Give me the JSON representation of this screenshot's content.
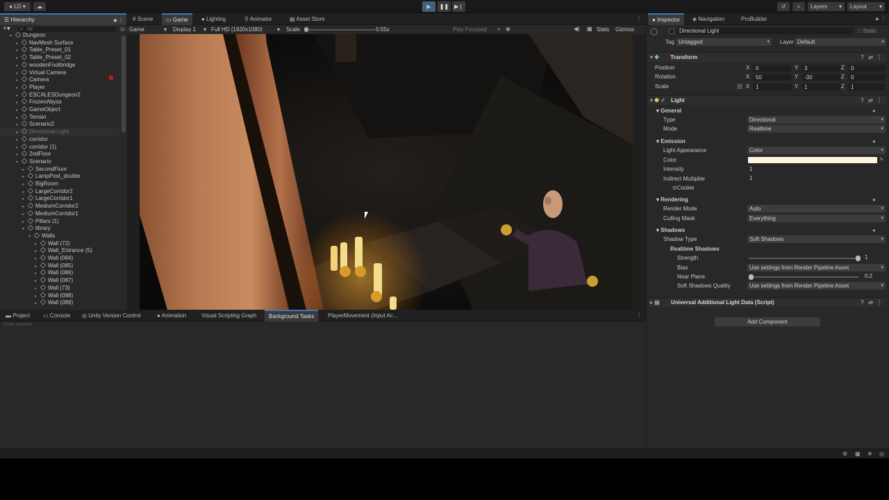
{
  "toolbar": {
    "account": "LD",
    "layers": "Layers",
    "layout": "Layout"
  },
  "hierarchy": {
    "tab": "Hierarchy",
    "search_placeholder": "All",
    "items": [
      {
        "label": "Dungeon",
        "indent": 0,
        "expanded": true
      },
      {
        "label": "NavMesh Surface",
        "indent": 1
      },
      {
        "label": "Table_Preset_01",
        "indent": 1
      },
      {
        "label": "Table_Preset_02",
        "indent": 1
      },
      {
        "label": "woodenFootbridge",
        "indent": 1
      },
      {
        "label": "Virtual Camera",
        "indent": 1
      },
      {
        "label": "Camera",
        "indent": 1
      },
      {
        "label": "Player",
        "indent": 1
      },
      {
        "label": "ESCALESDungeon2",
        "indent": 1
      },
      {
        "label": "FrozenAbyss",
        "indent": 1
      },
      {
        "label": "GameObject",
        "indent": 1
      },
      {
        "label": "Terrain",
        "indent": 1
      },
      {
        "label": "Scenario2",
        "indent": 1
      },
      {
        "label": "Directional Light",
        "indent": 1,
        "disabled": true
      },
      {
        "label": "corridor",
        "indent": 1
      },
      {
        "label": "corridor (1)",
        "indent": 1
      },
      {
        "label": "2ndFloor",
        "indent": 1
      },
      {
        "label": "Scenario",
        "indent": 1,
        "expanded": true
      },
      {
        "label": "SecondFloor",
        "indent": 2
      },
      {
        "label": "LampPost_double",
        "indent": 2
      },
      {
        "label": "BigRoom",
        "indent": 2
      },
      {
        "label": "LargeCorridor2",
        "indent": 2
      },
      {
        "label": "LargeCorridor1",
        "indent": 2
      },
      {
        "label": "MediumCorridor2",
        "indent": 2
      },
      {
        "label": "MediumCorridor1",
        "indent": 2
      },
      {
        "label": "Pillars (1)",
        "indent": 2
      },
      {
        "label": "library",
        "indent": 2,
        "expanded": true
      },
      {
        "label": "Walls",
        "indent": 3,
        "expanded": true
      },
      {
        "label": "Wall (72)",
        "indent": 4
      },
      {
        "label": "Wall_Entrance (5)",
        "indent": 4
      },
      {
        "label": "Wall (084)",
        "indent": 4
      },
      {
        "label": "Wall (085)",
        "indent": 4
      },
      {
        "label": "Wall (086)",
        "indent": 4
      },
      {
        "label": "Wall (087)",
        "indent": 4
      },
      {
        "label": "Wall (73)",
        "indent": 4
      },
      {
        "label": "Wall (088)",
        "indent": 4
      },
      {
        "label": "Wall (089)",
        "indent": 4
      }
    ]
  },
  "center_tabs": [
    "Scene",
    "Game",
    "Lighting",
    "Animator",
    "Asset Store"
  ],
  "game_bar": {
    "mode": "Game",
    "display": "Display 1",
    "resolution": "Full HD (1920x1080)",
    "scale_label": "Scale",
    "scale_value": "0.55x",
    "play_focused": "Play Focused",
    "stats": "Stats",
    "gizmos": "Gizmos"
  },
  "bottom_tabs": [
    "Project",
    "Console",
    "Unity Version Control",
    "Animation",
    "Visual Scripting Graph",
    "Background Tasks",
    "PlayerMovement (Input Ac..."
  ],
  "bottom_placeholder": "Clear inactive",
  "inspector": {
    "tabs": [
      "Inspector",
      "Navigation",
      "ProBuilder"
    ],
    "object_name": "Directional Light",
    "static_label": "Static",
    "tag_label": "Tag",
    "tag_value": "Untagged",
    "layer_label": "Layer",
    "layer_value": "Default",
    "transform": {
      "title": "Transform",
      "position_label": "Position",
      "rotation_label": "Rotation",
      "scale_label": "Scale",
      "position": [
        "0",
        "3",
        "0"
      ],
      "rotation": [
        "50",
        "-30",
        "0"
      ],
      "scale": [
        "1",
        "1",
        "1"
      ]
    },
    "light": {
      "title": "Light",
      "general": "General",
      "type_label": "Type",
      "type_value": "Directional",
      "mode_label": "Mode",
      "mode_value": "Realtime",
      "emission": "Emission",
      "appearance_label": "Light Appearance",
      "appearance_value": "Color",
      "color_label": "Color",
      "color_hex": "#fff5dd",
      "intensity_label": "Intensity",
      "intensity_value": "1",
      "indirect_label": "Indirect Multiplier",
      "indirect_value": "1",
      "cookie_label": "Cookie",
      "rendering": "Rendering",
      "render_mode_label": "Render Mode",
      "render_mode_value": "Auto",
      "culling_label": "Culling Mask",
      "culling_value": "Everything",
      "shadows": "Shadows",
      "shadow_type_label": "Shadow Type",
      "shadow_type_value": "Soft Shadows",
      "realtime_shadows": "Realtime Shadows",
      "strength_label": "Strength",
      "strength_value": "1",
      "bias_label": "Bias",
      "bias_value": "Use settings from Render Pipeline Asset",
      "near_plane_label": "Near Plane",
      "near_plane_value": "0.2",
      "soft_quality_label": "Soft Shadows Quality",
      "soft_quality_value": "Use settings from Render Pipeline Asset"
    },
    "additional_data": "Universal Additional Light Data (Script)",
    "add_component": "Add Component"
  }
}
